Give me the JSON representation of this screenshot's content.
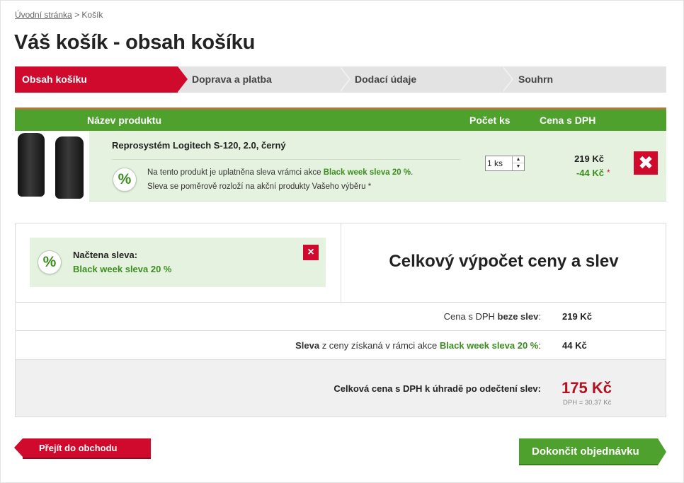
{
  "breadcrumb": {
    "home": "Úvodní stránka",
    "separator": ">",
    "current": "Košík"
  },
  "page_title": "Váš košík - obsah košíku",
  "steps": [
    {
      "label": "Obsah košíku",
      "active": true
    },
    {
      "label": "Doprava a platba",
      "active": false
    },
    {
      "label": "Dodací údaje",
      "active": false
    },
    {
      "label": "Souhrn",
      "active": false
    }
  ],
  "table": {
    "headers": {
      "product": "Název produktu",
      "qty": "Počet ks",
      "price": "Cena s DPH"
    },
    "items": [
      {
        "name": "Reprosystém Logitech S-120, 2.0, černý",
        "note_prefix": "Na tento produkt je uplatněna sleva vrámci akce",
        "note_promo": "Black week sleva 20 %",
        "note_suffix": ".",
        "note_line2": "Sleva se poměrově rozloží na akční produkty Vašeho výběru *",
        "qty": "1 ks",
        "price": "219 Kč",
        "discount": "-44 Kč",
        "discount_mark": "*"
      }
    ]
  },
  "discount_panel": {
    "title": "Načtena sleva:",
    "name": "Black week sleva 20 %",
    "remove": "×"
  },
  "summary": {
    "title": "Celkový výpočet ceny a slev",
    "row1_label_a": "Cena s DPH",
    "row1_label_b": "beze slev",
    "row1_label_c": ":",
    "row1_value": "219 Kč",
    "row2_label_a": "Sleva",
    "row2_label_b": "z ceny získaná v rámci akce",
    "row2_label_c": "Black week sleva 20 %",
    "row2_label_d": ":",
    "row2_value": "44 Kč",
    "total_label": "Celková cena s DPH k úhradě po odečtení slev:",
    "total_value": "175 Kč",
    "vat_note": "DPH = 30,37 Kč"
  },
  "buttons": {
    "back": "Přejít do obchodu",
    "finish": "Dokončit objednávku"
  },
  "icons": {
    "percent": "%",
    "delete": "✖",
    "spin_up": "▲",
    "spin_down": "▼"
  },
  "colors": {
    "brand_red": "#cf0a2c",
    "brand_green": "#4fa12e",
    "total_red": "#b5101f"
  }
}
